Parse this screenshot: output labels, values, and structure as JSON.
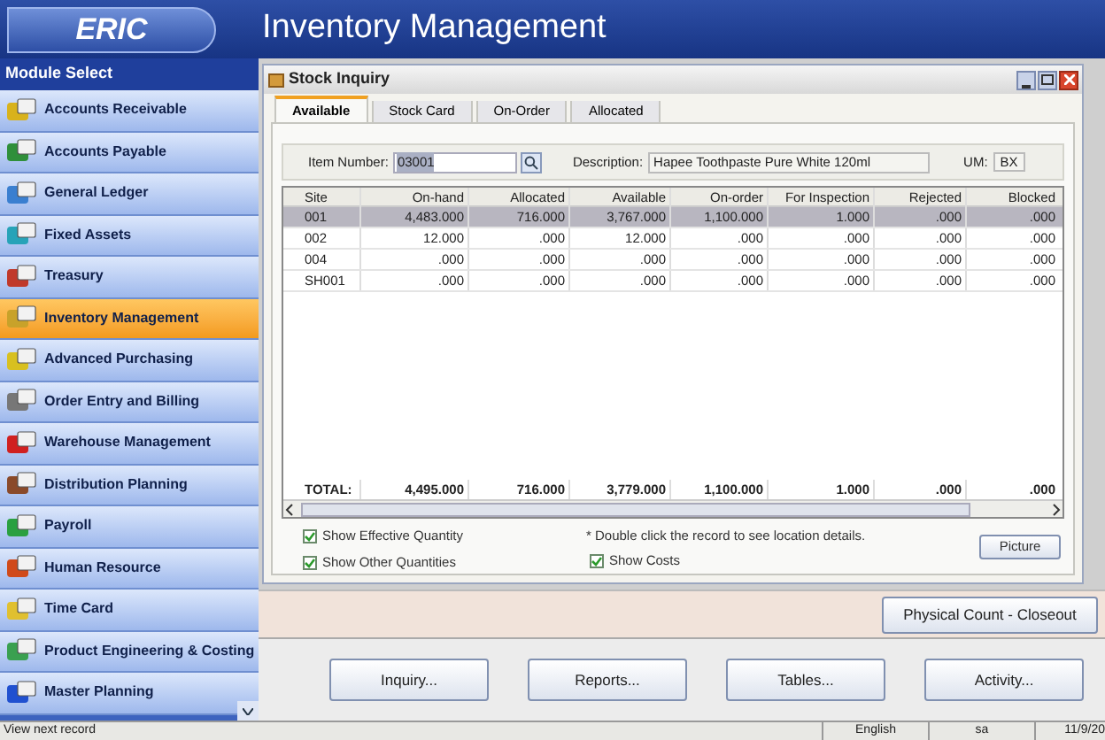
{
  "app": {
    "logo": "ERIC",
    "title": "Inventory Management"
  },
  "sidebar": {
    "title": "Module Select",
    "items": [
      {
        "label": "Accounts Receivable",
        "selected": false
      },
      {
        "label": "Accounts Payable",
        "selected": false
      },
      {
        "label": "General Ledger",
        "selected": false
      },
      {
        "label": "Fixed Assets",
        "selected": false
      },
      {
        "label": "Treasury",
        "selected": false
      },
      {
        "label": "Inventory Management",
        "selected": true
      },
      {
        "label": "Advanced Purchasing",
        "selected": false
      },
      {
        "label": "Order Entry and Billing",
        "selected": false
      },
      {
        "label": "Warehouse Management",
        "selected": false
      },
      {
        "label": "Distribution Planning",
        "selected": false
      },
      {
        "label": "Payroll",
        "selected": false
      },
      {
        "label": "Human Resource",
        "selected": false
      },
      {
        "label": "Time Card",
        "selected": false
      },
      {
        "label": "Product Engineering & Costing",
        "selected": false
      },
      {
        "label": "Master Planning",
        "selected": false
      }
    ]
  },
  "window": {
    "title": "Stock Inquiry",
    "tabs": [
      {
        "label": "Available",
        "selected": true
      },
      {
        "label": "Stock Card",
        "selected": false
      },
      {
        "label": "On-Order",
        "selected": false
      },
      {
        "label": "Allocated",
        "selected": false
      }
    ],
    "item_number": {
      "label": "Item Number:",
      "value": "03001"
    },
    "description": {
      "label": "Description:",
      "value": "Hapee Toothpaste Pure White 120ml"
    },
    "um": {
      "label": "UM:",
      "value": "BX"
    },
    "table": {
      "columns": [
        "Site",
        "On-hand",
        "Allocated",
        "Available",
        "On-order",
        "For Inspection",
        "Rejected",
        "Blocked"
      ],
      "rows": [
        {
          "cells": [
            "001",
            "4,483.000",
            "716.000",
            "3,767.000",
            "1,100.000",
            "1.000",
            ".000",
            ".000"
          ],
          "selected": true
        },
        {
          "cells": [
            "002",
            "12.000",
            ".000",
            "12.000",
            ".000",
            ".000",
            ".000",
            ".000"
          ],
          "selected": false
        },
        {
          "cells": [
            "004",
            ".000",
            ".000",
            ".000",
            ".000",
            ".000",
            ".000",
            ".000"
          ],
          "selected": false
        },
        {
          "cells": [
            "SH001",
            ".000",
            ".000",
            ".000",
            ".000",
            ".000",
            ".000",
            ".000"
          ],
          "selected": false
        }
      ],
      "total": [
        "TOTAL:",
        "4,495.000",
        "716.000",
        "3,779.000",
        "1,100.000",
        "1.000",
        ".000",
        ".000"
      ]
    },
    "checkboxes": [
      {
        "label": "Show Effective Quantity",
        "checked": true
      },
      {
        "label": "Show Other Quantities",
        "checked": true
      }
    ],
    "note": "* Double click the record to see location details.",
    "show_costs": {
      "label": "Show Costs",
      "checked": true
    },
    "picture_button": "Picture"
  },
  "closeout_button": "Physical Count - Closeout",
  "buttons": [
    "Inquiry...",
    "Reports...",
    "Tables...",
    "Activity..."
  ],
  "status_bar": {
    "message": "View next record",
    "language": "English",
    "user": "sa",
    "date": "11/9/20"
  }
}
